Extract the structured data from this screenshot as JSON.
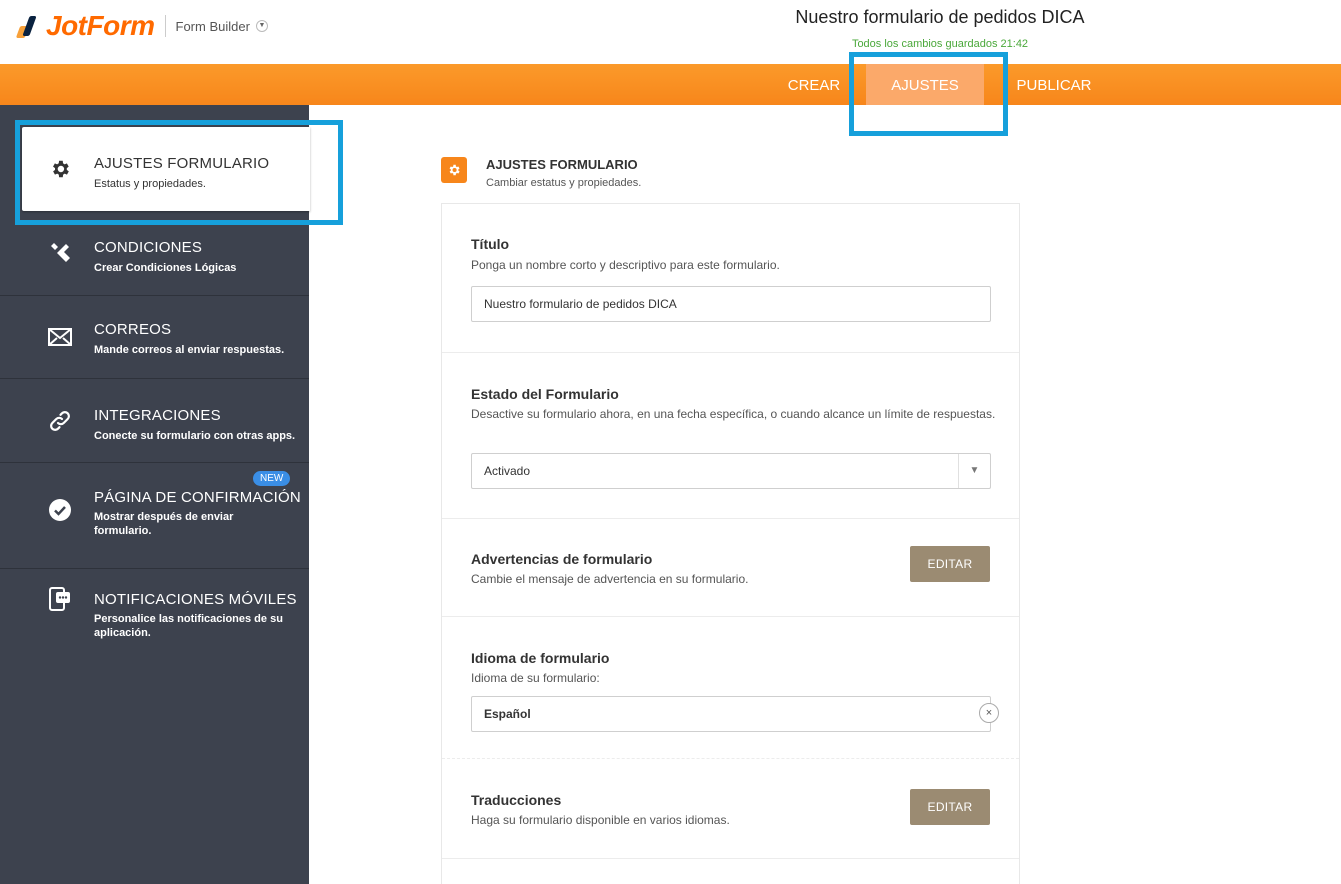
{
  "header": {
    "logo_text": "JotForm",
    "builder_label": "Form Builder",
    "form_title": "Nuestro formulario de pedidos DICA",
    "saved_status": "Todos los cambios guardados 21:42"
  },
  "nav": {
    "tabs": [
      {
        "label": "CREAR"
      },
      {
        "label": "AJUSTES"
      },
      {
        "label": "PUBLICAR"
      }
    ],
    "active_tab": "AJUSTES"
  },
  "sidebar": {
    "items": [
      {
        "title": "AJUSTES FORMULARIO",
        "subtitle": "Estatus y propiedades.",
        "icon": "gear-icon"
      },
      {
        "title": "CONDICIONES",
        "subtitle": "Crear Condiciones Lógicas",
        "icon": "tools-icon"
      },
      {
        "title": "CORREOS",
        "subtitle": "Mande correos al enviar respuestas.",
        "icon": "envelope-icon"
      },
      {
        "title": "INTEGRACIONES",
        "subtitle": "Conecte su formulario con otras apps.",
        "icon": "link-icon"
      },
      {
        "title": "PÁGINA DE CONFIRMACIÓN",
        "subtitle": "Mostrar después de enviar formulario.",
        "icon": "check-circle-icon",
        "badge": "NEW"
      },
      {
        "title": "NOTIFICACIONES MÓVILES",
        "subtitle": "Personalice las notificaciones de su aplicación.",
        "icon": "mobile-notification-icon"
      }
    ]
  },
  "main": {
    "header_title": "AJUSTES FORMULARIO",
    "header_subtitle": "Cambiar estatus y propiedades.",
    "title_section": {
      "title": "Título",
      "description": "Ponga un nombre corto y descriptivo para este formulario.",
      "value": "Nuestro formulario de pedidos DICA"
    },
    "status_section": {
      "title": "Estado del Formulario",
      "description": "Desactive su formulario ahora, en una fecha específica, o cuando alcance un límite de respuestas.",
      "selected": "Activado"
    },
    "warnings_section": {
      "title": "Advertencias de formulario",
      "description": "Cambie el mensaje de advertencia en su formulario.",
      "button": "EDITAR"
    },
    "language_section": {
      "title": "Idioma de formulario",
      "description": "Idioma de su formulario:",
      "value": "Español",
      "clear": "×"
    },
    "translations_section": {
      "title": "Traducciones",
      "description": "Haga su formulario disponible en varios idiomas.",
      "button": "EDITAR"
    }
  },
  "colors": {
    "accent_orange": "#f7861b",
    "sidebar_bg": "#3d424e",
    "highlight_blue": "#16a0db",
    "edit_button": "#9b8b72",
    "saved_green": "#4aa83a"
  }
}
